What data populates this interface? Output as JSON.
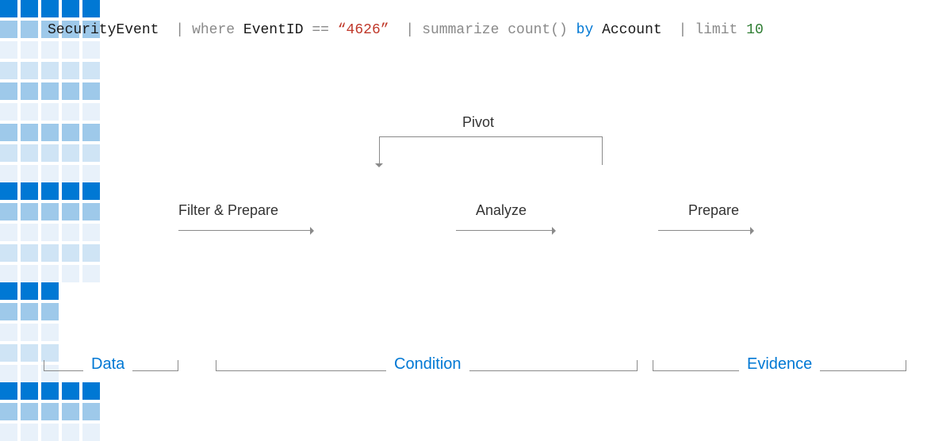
{
  "query": {
    "tokens": [
      {
        "text": "SecurityEvent",
        "cls": "tk-black"
      },
      {
        "text": "|",
        "cls": "pipe"
      },
      {
        "text": "where",
        "cls": "tk-gray"
      },
      {
        "text": " EventID",
        "cls": "tk-black"
      },
      {
        "text": " ==",
        "cls": "tk-gray"
      },
      {
        "text": " “4626”",
        "cls": "tk-red"
      },
      {
        "text": "|",
        "cls": "pipe"
      },
      {
        "text": "summarize",
        "cls": "tk-gray"
      },
      {
        "text": " count()",
        "cls": "tk-gray"
      },
      {
        "text": " by",
        "cls": "tk-blue"
      },
      {
        "text": " Account",
        "cls": "tk-black"
      },
      {
        "text": "|",
        "cls": "pipe"
      },
      {
        "text": "limit",
        "cls": "tk-gray"
      },
      {
        "text": " 10",
        "cls": "tk-green"
      }
    ]
  },
  "labels": {
    "filter_prepare": "Filter & Prepare",
    "analyze": "Analyze",
    "prepare": "Prepare",
    "pivot": "Pivot"
  },
  "groups": {
    "data": "Data",
    "condition": "Condition",
    "evidence": "Evidence"
  },
  "grids": {
    "data": {
      "cols": 5,
      "rows": 9,
      "shade_map": [
        "dark",
        "mid",
        "vlight",
        "light",
        "mid",
        "vlight",
        "mid",
        "light",
        "vlight"
      ]
    },
    "condA": {
      "cols": 5,
      "rows": 5,
      "shade_map": [
        "dark",
        "mid",
        "vlight",
        "light",
        "vlight"
      ]
    },
    "condB": {
      "cols": 3,
      "rows": 5,
      "shade_map": [
        "dark",
        "mid",
        "vlight",
        "light",
        "vlight"
      ]
    },
    "evidence": {
      "cols": 5,
      "rows": 3,
      "shade_map": [
        "dark",
        "mid",
        "vlight"
      ]
    }
  },
  "colors": {
    "accent": "#0078d4",
    "gray": "#8a8a8a"
  }
}
